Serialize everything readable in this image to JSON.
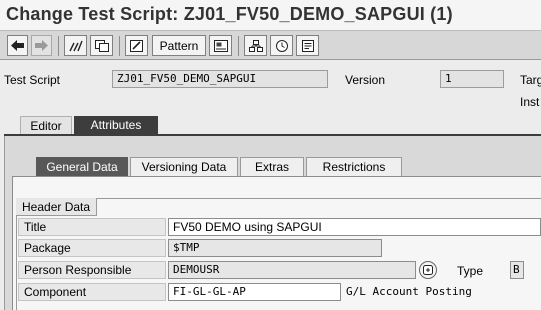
{
  "window": {
    "title": "Change Test Script: ZJ01_FV50_DEMO_SAPGUI (1)"
  },
  "toolbar": {
    "pattern_label": "Pattern"
  },
  "header": {
    "test_script_label": "Test Script",
    "test_script_value": "ZJ01_FV50_DEMO_SAPGUI",
    "version_label": "Version",
    "version_value": "1",
    "target_label_partial": "Targ",
    "inst_label_partial": "Inst"
  },
  "outer_tabs": [
    {
      "label": "Editor"
    },
    {
      "label": "Attributes"
    }
  ],
  "inner_tabs": [
    {
      "label": "General Data"
    },
    {
      "label": "Versioning Data"
    },
    {
      "label": "Extras"
    },
    {
      "label": "Restrictions"
    }
  ],
  "header_data": {
    "group_title": "Header Data",
    "title_label": "Title",
    "title_value": "FV50 DEMO using SAPGUI",
    "package_label": "Package",
    "package_value": "$TMP",
    "person_label": "Person Responsible",
    "person_value": "DEMOUSR",
    "type_label": "Type",
    "type_value": "B",
    "component_label": "Component",
    "component_value": "FI-GL-GL-AP",
    "component_description": "G/L Account Posting"
  }
}
